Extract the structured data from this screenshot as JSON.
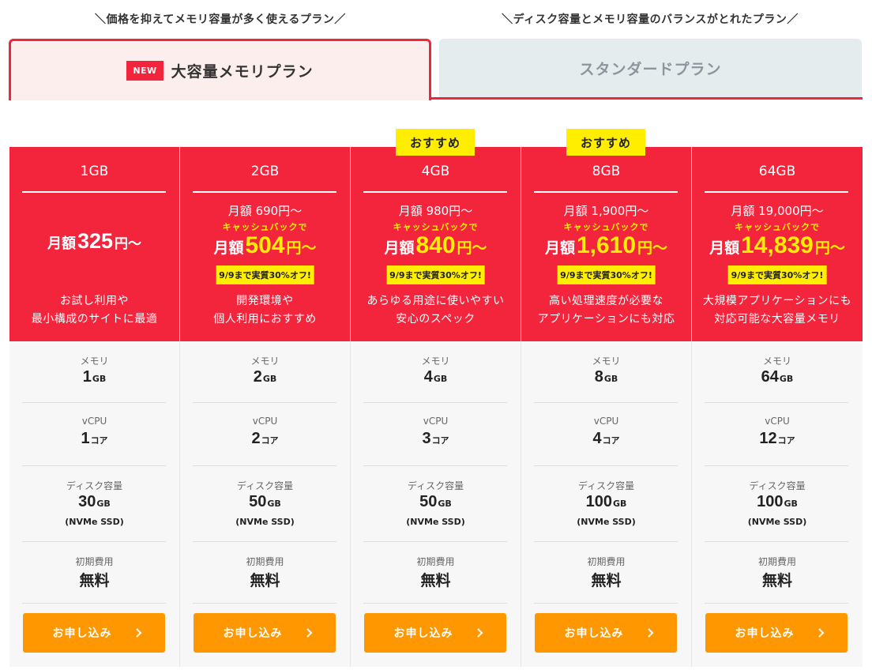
{
  "tabs": {
    "caption_left": "＼価格を抑えてメモリ容量が多く使えるプラン／",
    "caption_right": "＼ディスク容量とメモリ容量のバランスがとれたプラン／",
    "active_badge": "NEW",
    "active_label": "大容量メモリプラン",
    "inactive_label": "スタンダードプラン"
  },
  "labels": {
    "recommend": "おすすめ",
    "cashback": "キャッシュバックで",
    "price_prefix": "月額",
    "price_suffix": "円〜",
    "memory": "メモリ",
    "vcpu": "vCPU",
    "disk": "ディスク容量",
    "disk_note": "(NVMe SSD)",
    "setup_fee": "初期費用",
    "setup_fee_value": "無料",
    "apply": "お申し込み",
    "unit_gb": "GB",
    "unit_core": "コア"
  },
  "colors": {
    "brand_red": "#f3253d",
    "highlight_yellow": "#ffee00",
    "button_orange": "#ff9800",
    "inactive_tab": "#e5ecee"
  },
  "plans": [
    {
      "size": "1GB",
      "price": "325",
      "desc1": "お試し利用や",
      "desc2": "最小構成のサイトに最適",
      "memory": "1",
      "vcpu": "1",
      "disk": "30"
    },
    {
      "size": "2GB",
      "base_price": "月額 690円〜",
      "cashback_price": "504",
      "discount": "9/9まで実質30%オフ!",
      "desc1": "開発環境や",
      "desc2": "個人利用におすすめ",
      "memory": "2",
      "vcpu": "2",
      "disk": "50"
    },
    {
      "size": "4GB",
      "base_price": "月額 980円〜",
      "cashback_price": "840",
      "discount": "9/9まで実質30%オフ!",
      "desc1": "あらゆる用途に使いやすい",
      "desc2": "安心のスペック",
      "memory": "4",
      "vcpu": "3",
      "disk": "50"
    },
    {
      "size": "8GB",
      "base_price": "月額 1,900円〜",
      "cashback_price": "1,610",
      "discount": "9/9まで実質30%オフ!",
      "desc1": "高い処理速度が必要な",
      "desc2": "アプリケーションにも対応",
      "memory": "8",
      "vcpu": "4",
      "disk": "100"
    },
    {
      "size": "64GB",
      "base_price": "月額 19,000円〜",
      "cashback_price": "14,839",
      "discount": "9/9まで実質30%オフ!",
      "desc1": "大規模アプリケーションにも",
      "desc2": "対応可能な大容量メモリ",
      "memory": "64",
      "vcpu": "12",
      "disk": "100"
    }
  ]
}
